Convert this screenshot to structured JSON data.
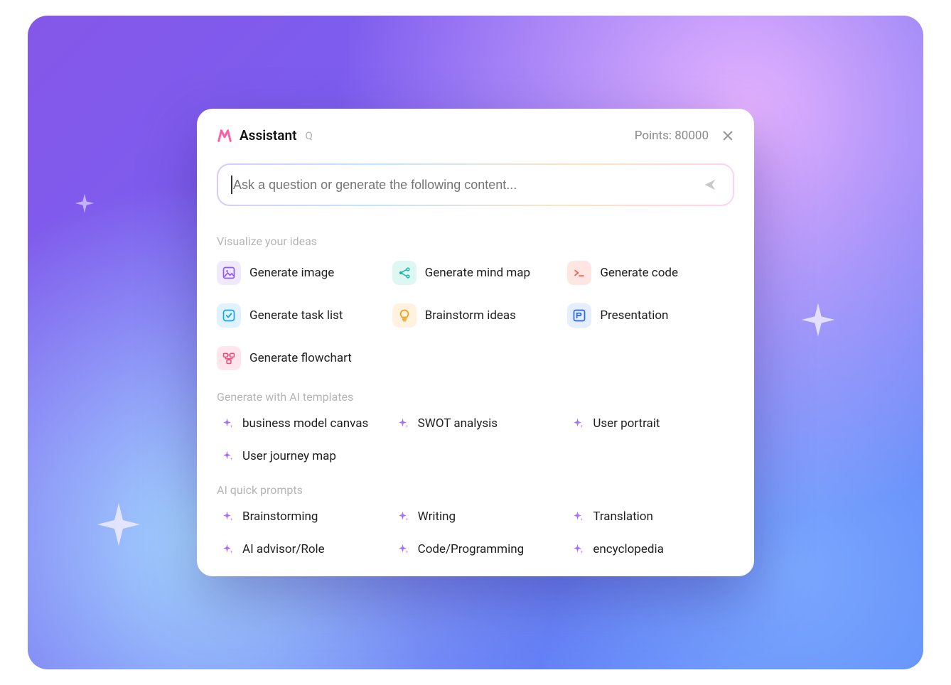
{
  "header": {
    "title": "Assistant",
    "q": "Q",
    "points_label": "Points: 80000"
  },
  "input": {
    "placeholder": "Ask a question or generate the following content..."
  },
  "sections": {
    "visualize": {
      "title": "Visualize your ideas",
      "items": [
        {
          "label": "Generate image",
          "icon": "image-icon",
          "box": "purple"
        },
        {
          "label": "Generate mind map",
          "icon": "mindmap-icon",
          "box": "cyan"
        },
        {
          "label": "Generate code",
          "icon": "code-icon",
          "box": "red"
        },
        {
          "label": "Generate task list",
          "icon": "tasklist-icon",
          "box": "blue"
        },
        {
          "label": "Brainstorm ideas",
          "icon": "lightbulb-icon",
          "box": "orange"
        },
        {
          "label": "Presentation",
          "icon": "presentation-icon",
          "box": "bluep"
        },
        {
          "label": "Generate flowchart",
          "icon": "flowchart-icon",
          "box": "pink"
        }
      ]
    },
    "templates": {
      "title": "Generate with AI templates",
      "items": [
        {
          "label": "business model canvas"
        },
        {
          "label": "SWOT analysis"
        },
        {
          "label": "User portrait"
        },
        {
          "label": "User journey map"
        }
      ]
    },
    "prompts": {
      "title": "AI quick prompts",
      "items": [
        {
          "label": "Brainstorming"
        },
        {
          "label": "Writing"
        },
        {
          "label": "Translation"
        },
        {
          "label": "AI advisor/Role"
        },
        {
          "label": "Code/Programming"
        },
        {
          "label": "encyclopedia"
        }
      ]
    }
  }
}
